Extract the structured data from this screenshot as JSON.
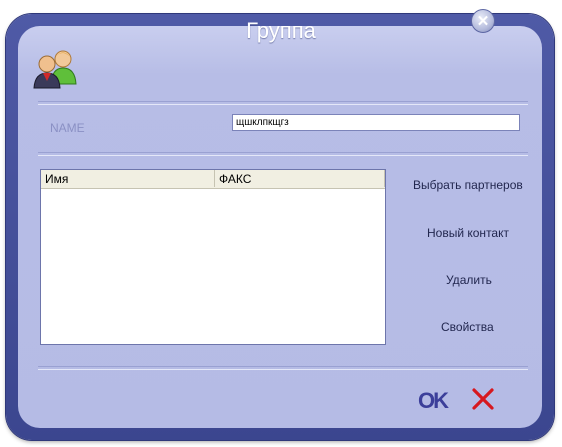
{
  "dialog": {
    "title": "Группа",
    "close_icon": "close-icon",
    "avatar_icon": "group-users-icon"
  },
  "name_field": {
    "label": "NAME",
    "value": "щшклпкщгз"
  },
  "table": {
    "columns": [
      "Имя",
      "ФАКС"
    ],
    "rows": []
  },
  "actions": {
    "choose_partners": "Выбрать партнеров",
    "new_contact": "Новый контакт",
    "delete": "Удалить",
    "properties": "Свойства"
  },
  "footer": {
    "ok_label": "OK",
    "cancel_icon": "cancel-x-icon"
  },
  "colors": {
    "frame": "#4f5aa6",
    "panel": "#b5bbe5",
    "cancel_red": "#d6181f"
  }
}
